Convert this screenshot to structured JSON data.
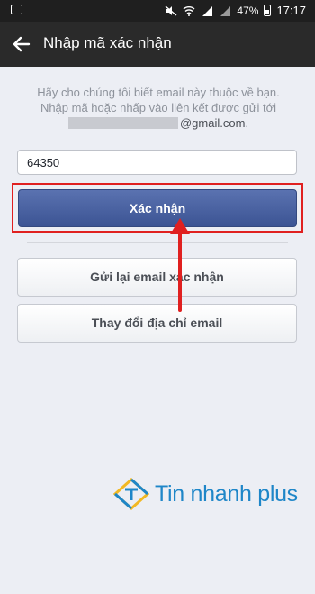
{
  "status_bar": {
    "battery_percent": "47%",
    "time": "17:17"
  },
  "app_bar": {
    "title": "Nhập mã xác nhận"
  },
  "description": {
    "line1": "Hãy cho chúng tôi biết email này thuộc về bạn.",
    "line2": "Nhập mã hoặc nhấp vào liên kết được gửi tới",
    "email_suffix": "@gmail.com",
    "email_end": "."
  },
  "code_input": {
    "value": "64350"
  },
  "buttons": {
    "confirm_label": "Xác nhận",
    "resend_label": "Gửi lại email xác nhận",
    "change_email_label": "Thay đổi địa chỉ email"
  },
  "watermark": {
    "text": "Tin nhanh plus"
  },
  "colors": {
    "accent_blue": "#3c5494",
    "highlight_red": "#e02020",
    "watermark_blue": "#1e86c8"
  }
}
